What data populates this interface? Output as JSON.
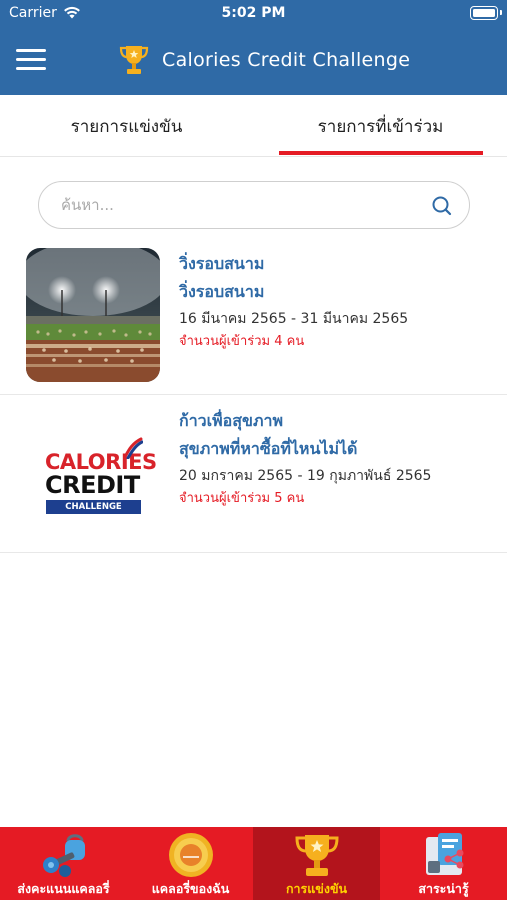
{
  "status_bar": {
    "carrier": "Carrier",
    "time": "5:02 PM"
  },
  "header": {
    "title": "Calories Credit Challenge",
    "background_color": "#2f6aa6",
    "menu_icon": "hamburger-menu-icon",
    "logo_icon": "trophy-icon"
  },
  "tabs": [
    {
      "label": "รายการแข่งขัน",
      "active": false
    },
    {
      "label": "รายการที่เข้าร่วม",
      "active": true
    }
  ],
  "search": {
    "placeholder": "ค้นหา...",
    "value": "",
    "icon": "search-icon"
  },
  "events": [
    {
      "title": "วิ่งรอบสนาม",
      "subtitle": "วิ่งรอบสนาม",
      "date_range": "16 มีนาคม 2565 - 31 มีนาคม 2565",
      "participants": "จำนวนผู้เข้าร่วม 4 คน",
      "thumbnail": "stadium-photo"
    },
    {
      "title": "ก้าวเพื่อสุขภาพ",
      "subtitle": "สุขภาพที่หาซื้อที่ไหนไม่ได้",
      "date_range": "20 มกราคม 2565 - 19 กุมภาพันธ์ 2565",
      "participants": "จำนวนผู้เข้าร่วม 5 คน",
      "thumbnail": "calories-credit-logo",
      "logo_text": [
        "CALORIES",
        "CREDIT",
        "CHALLENGE"
      ]
    }
  ],
  "bottom_nav": [
    {
      "label": "ส่งคะแนนแคลอรี่",
      "icon": "dumbbell-icon",
      "active": false
    },
    {
      "label": "แคลอรี่ของฉัน",
      "icon": "coin-medal-icon",
      "active": false
    },
    {
      "label": "การแข่งขัน",
      "icon": "trophy-icon",
      "active": true
    },
    {
      "label": "สาระน่ารู้",
      "icon": "share-device-icon",
      "active": false
    }
  ],
  "colors": {
    "accent_red": "#e51b24",
    "active_tab_bg": "#b3141c",
    "active_label": "#ffd200",
    "title_blue": "#2f6aa6"
  }
}
